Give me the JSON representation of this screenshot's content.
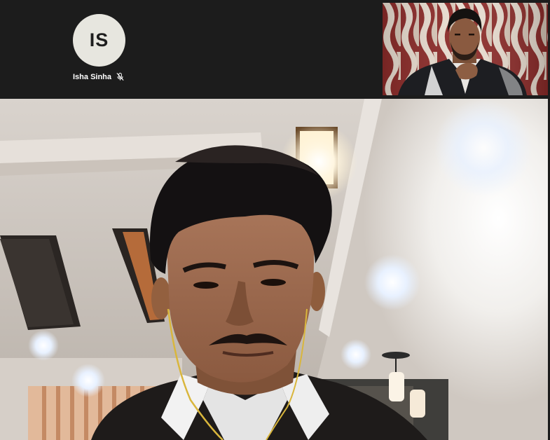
{
  "participants": {
    "no_video_tile": {
      "initials": "IS",
      "name": "Isha Sinha",
      "audio_icon": "microphone-muted-icon"
    }
  },
  "colors": {
    "background": "#1c1c1c",
    "avatar_bg": "#e7e6df",
    "name_text": "#ffffff"
  }
}
